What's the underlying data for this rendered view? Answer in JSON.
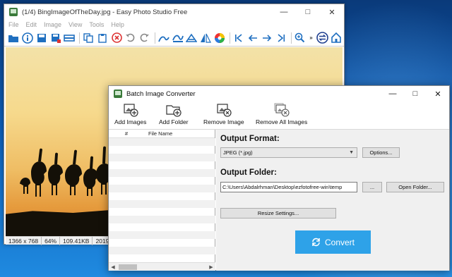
{
  "main_window": {
    "title": "(1/4) BingImageOfTheDay.jpg - Easy Photo Studio Free",
    "menu": [
      "File",
      "Edit",
      "Image",
      "View",
      "Tools",
      "Help"
    ],
    "toolbar_icons": [
      "open-icon",
      "info-icon",
      "save-icon",
      "save-as-icon",
      "scan-icon",
      "copy-icon",
      "paste-icon",
      "delete-icon",
      "undo-icon",
      "redo-icon",
      "crop-icon",
      "effects-icon",
      "resize-icon",
      "flip-icon",
      "color-icon",
      "first-icon",
      "previous-icon",
      "next-icon",
      "last-icon",
      "zoom-icon",
      "more-icon",
      "convert-icon",
      "home-icon"
    ],
    "status": [
      "1366 x 768",
      "64%",
      "109.41KB",
      "2019-08-0"
    ]
  },
  "dialog": {
    "title": "Batch Image Converter",
    "toolbar": {
      "add_images": "Add Images",
      "add_folder": "Add Folder",
      "remove_image": "Remove Image",
      "remove_all": "Remove All Images"
    },
    "file_list": {
      "col_num": "#",
      "col_name": "File Name"
    },
    "output_format_label": "Output Format:",
    "output_format_value": "JPEG (*.jpg)",
    "options_button": "Options...",
    "output_folder_label": "Output Folder:",
    "output_folder_value": "C:\\Users\\Abdalrhman\\Desktop\\ezfotofree-win\\temp",
    "browse_button": "...",
    "open_folder_button": "Open Folder...",
    "resize_button": "Resize Settings...",
    "convert_button": "Convert"
  },
  "colors": {
    "accent": "#2ea2e8",
    "toolbar_icon": "#1f6fc0"
  }
}
